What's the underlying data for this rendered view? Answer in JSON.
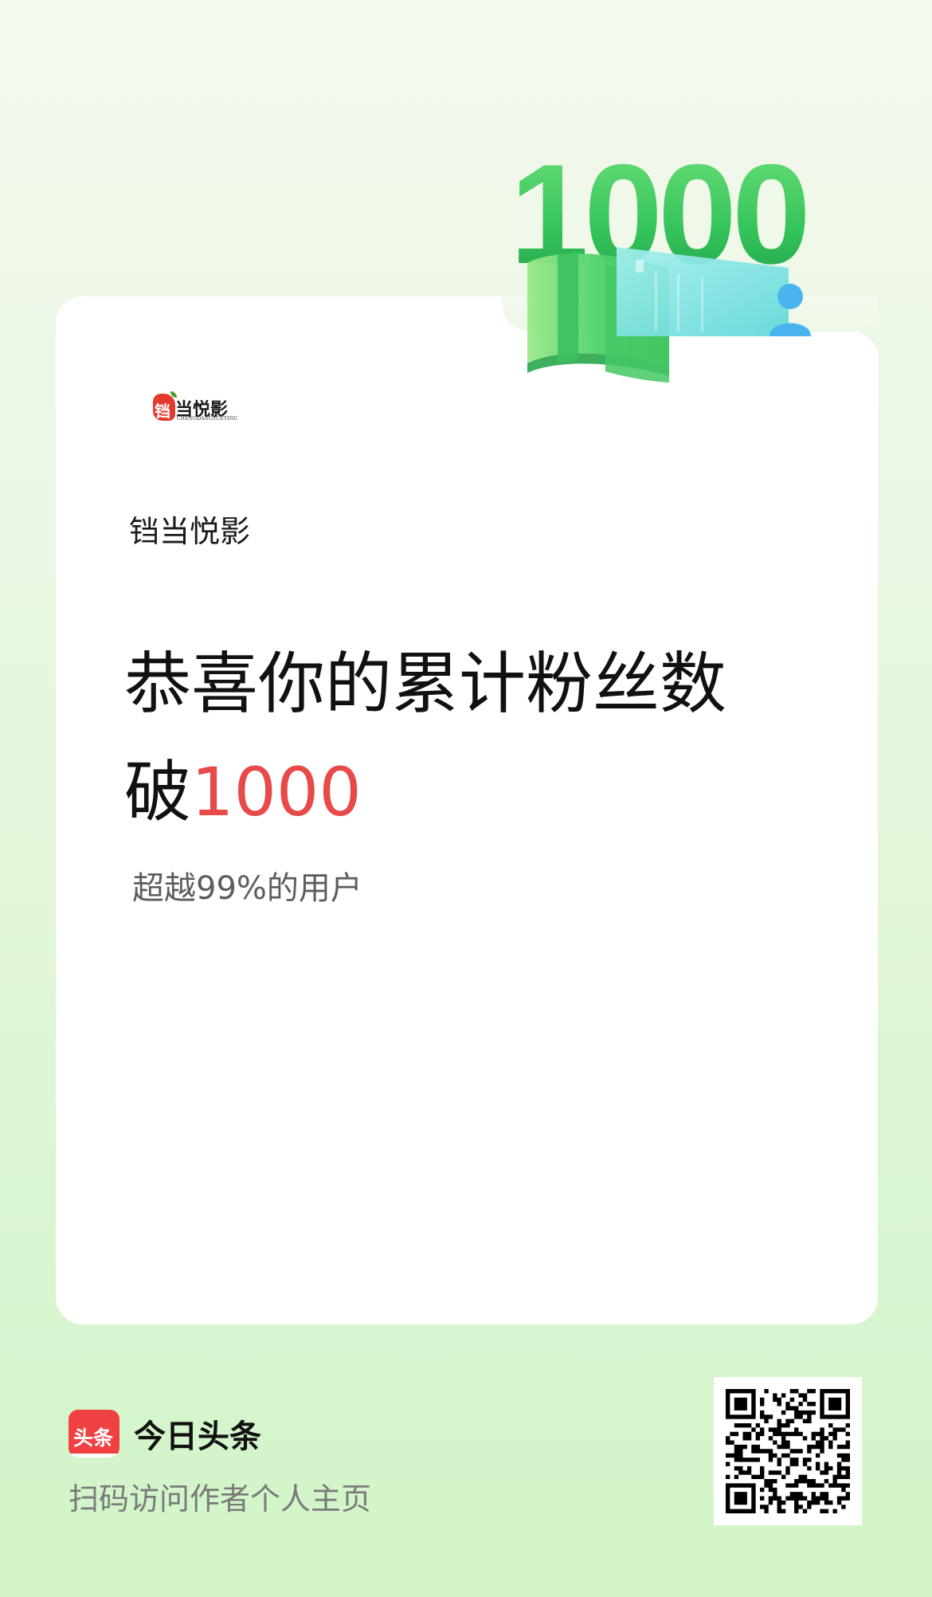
{
  "badge": {
    "number": "1000"
  },
  "logo": {
    "mark_char": "铛",
    "text": "当悦影",
    "subtext": "CHENGDANGYUEYING"
  },
  "author": {
    "name": "铛当悦影"
  },
  "headline": {
    "line1": "恭喜你的累计粉丝数",
    "line2_prefix": "破",
    "line2_number": "1000"
  },
  "subline": "超越99%的用户",
  "footer": {
    "brand_icon_text": "头条",
    "brand_name": "今日头条",
    "caption": "扫码访问作者个人主页",
    "qr_icon": "qr-code"
  },
  "colors": {
    "highlight": "#e84a4a",
    "brand_red": "#f04142",
    "badge_green": "#34c759"
  }
}
